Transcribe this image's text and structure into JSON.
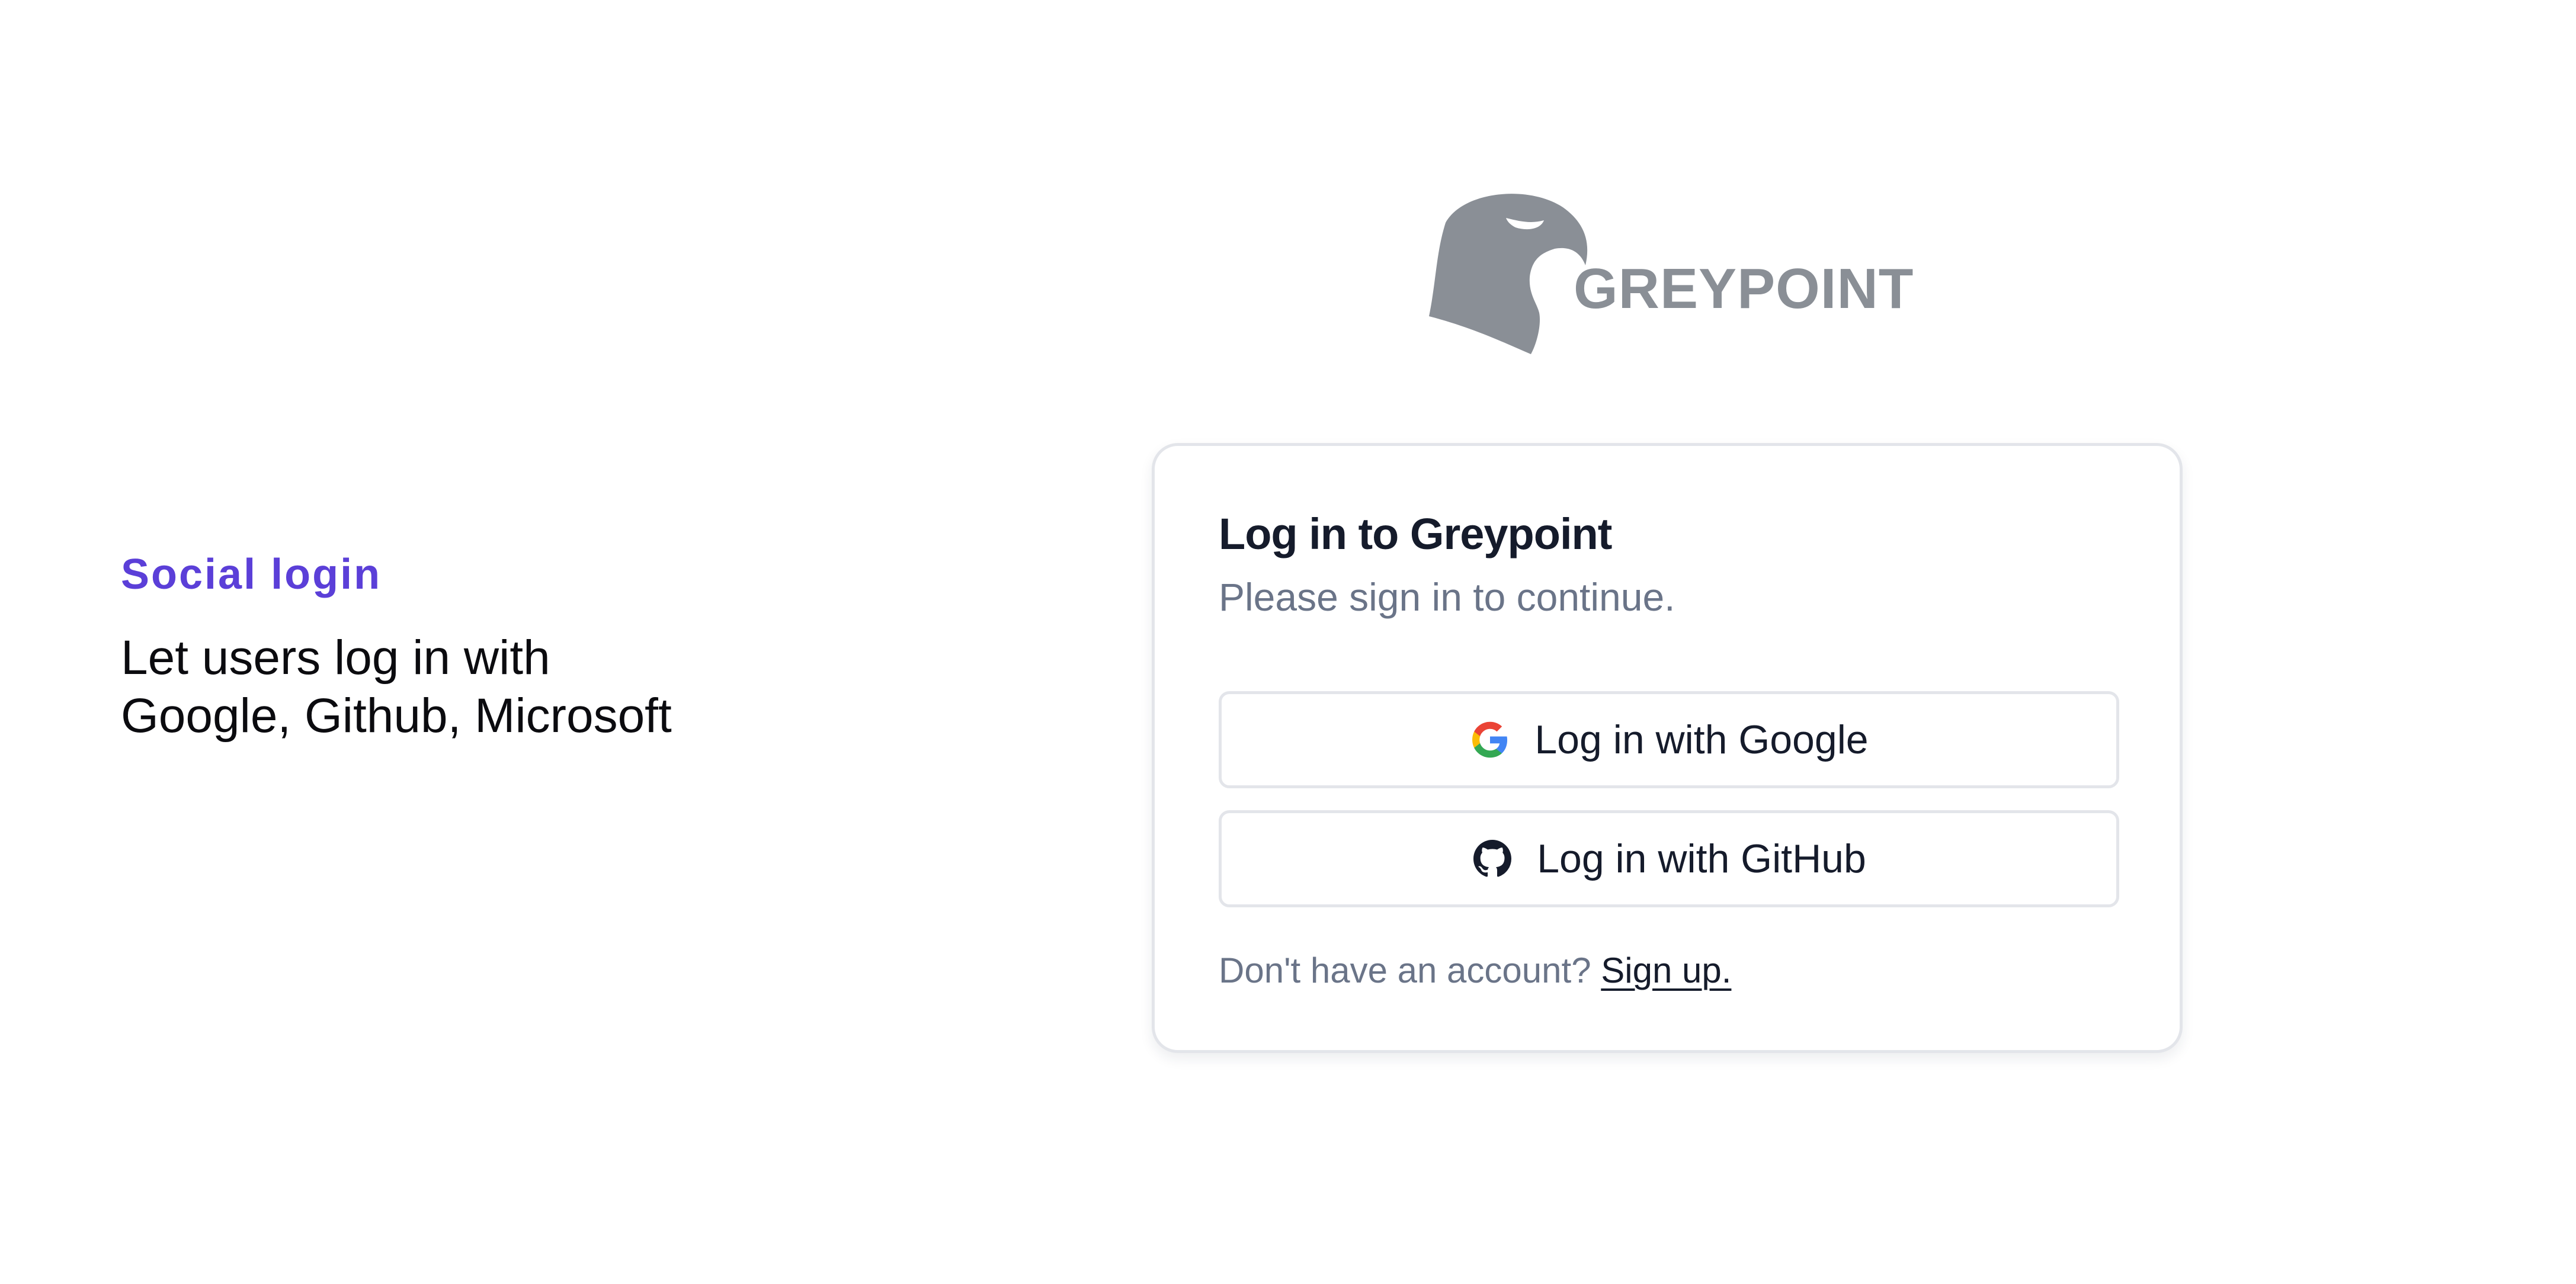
{
  "intro": {
    "eyebrow": "Social login",
    "headline_line1": "Let users log in with",
    "headline_line2": "Google, Github, Microsoft"
  },
  "brand": {
    "name": "GREYPOINT",
    "logo_icon": "eagle-head-icon",
    "logo_color": "#8a8f96"
  },
  "card": {
    "title": "Log in to Greypoint",
    "subtitle": "Please sign in to continue.",
    "buttons": [
      {
        "label": "Log in with Google",
        "icon": "google-icon"
      },
      {
        "label": "Log in with GitHub",
        "icon": "github-icon"
      }
    ],
    "footer_prompt": "Don't have an account?",
    "signup_label": "Sign up."
  },
  "colors": {
    "accent": "#5b3fd8",
    "text_primary": "#151b2b",
    "text_muted": "#6a7488",
    "border": "#e3e5ea"
  }
}
